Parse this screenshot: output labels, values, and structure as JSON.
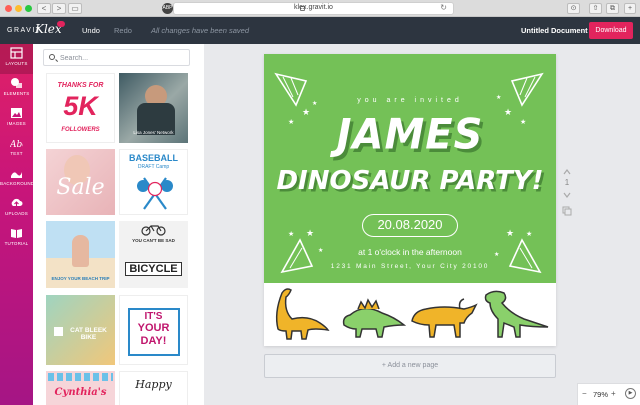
{
  "browser": {
    "url": "klex.gravit.io",
    "ext_badge": "ABP",
    "nav_back": "<",
    "nav_forward": ">",
    "reload_glyph": "↻"
  },
  "app": {
    "brand_prefix": "GRAVIT",
    "brand_name": "Klex",
    "undo_label": "Undo",
    "redo_label": "Redo",
    "save_status": "All changes have been saved",
    "document_title": "Untitled Document",
    "download_label": "Download",
    "accent_color": "#e2245d",
    "topbar_color": "#2d3540"
  },
  "rail": {
    "items": [
      {
        "label": "LAYOUTS",
        "icon": "layouts-icon"
      },
      {
        "label": "ELEMENTS",
        "icon": "elements-icon"
      },
      {
        "label": "IMAGES",
        "icon": "images-icon"
      },
      {
        "label": "TEXT",
        "icon": "text-icon"
      },
      {
        "label": "BACKGROUND",
        "icon": "background-icon"
      },
      {
        "label": "UPLOADS",
        "icon": "uploads-icon"
      },
      {
        "label": "TUTORIAL",
        "icon": "tutorial-icon"
      }
    ]
  },
  "panel": {
    "search_placeholder": "Search...",
    "templates": [
      {
        "line1": "THANKS FOR",
        "line2": "5K",
        "line3": "FOLLOWERS"
      },
      {
        "line1": "Lisa Jones' Network"
      },
      {
        "line1": "Sale"
      },
      {
        "line1": "BASEBALL",
        "line2": "DRAFT Camp"
      },
      {
        "line1": "ENJOY YOUR BEACH TRIP"
      },
      {
        "line1": "YOU CAN'T BE SAD",
        "line2": "BICYCLE"
      },
      {
        "line1": "CAT BLEEK BIKE"
      },
      {
        "line1": "IT'S",
        "line2": "YOUR",
        "line3": "DAY!"
      },
      {
        "line1": "Cynthia's"
      },
      {
        "line1": "Happy"
      }
    ]
  },
  "canvas": {
    "invited": "you are invited",
    "name": "JAMES",
    "party": "DINOSAUR PARTY!",
    "date": "20.08.2020",
    "time": "at 1 o'clock in the afternoon",
    "address": "1231 Main Street, Your City 20100",
    "green": "#74c157",
    "page_number": "1",
    "add_page": "+ Add a new page"
  },
  "zoom": {
    "minus": "−",
    "value": "79%",
    "plus": "+"
  }
}
